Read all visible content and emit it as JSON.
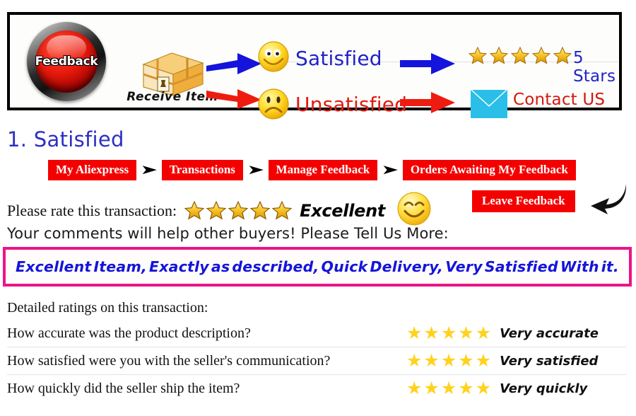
{
  "banner": {
    "feedback_button_label": "Feedback",
    "receive_item_label": "Receive Item",
    "satisfied_label": "Satisfied",
    "unsatisfied_label": "Unsatisfied",
    "five_stars_label": "5 Stars",
    "contact_us_label": "Contact US",
    "icons": {
      "package": "package-box-icon",
      "smile": "smiley-happy-icon",
      "frown": "smiley-sad-icon",
      "envelope": "envelope-icon",
      "blue_arrow": "arrow-right-blue-icon",
      "red_arrow": "arrow-right-red-icon"
    },
    "colors": {
      "satisfied_text": "#2222c8",
      "unsatisfied_text": "#e01b10",
      "blue_arrow": "#1414dc",
      "red_arrow": "#ee1c10",
      "envelope": "#29bfe8",
      "button_red": "#e81b0d"
    },
    "star_count": 5
  },
  "section": {
    "heading": "1. Satisfied"
  },
  "breadcrumb": {
    "separator": "➤",
    "items": [
      {
        "label": "My Aliexpress"
      },
      {
        "label": "Transactions"
      },
      {
        "label": "Manage Feedback"
      },
      {
        "label": "Orders Awaiting My Feedback"
      }
    ],
    "color": "#f40000"
  },
  "rating": {
    "prompt": "Please rate this transaction:",
    "stars": 5,
    "grade_label": "Excellent",
    "smiley_icon": "smiley-happy-icon",
    "leave_feedback_label": "Leave Feedback",
    "arrow_icon": "curved-arrow-icon"
  },
  "comments": {
    "prompt": "Your comments will help other buyers! Please Tell Us More:",
    "text": "Excellent Iteam, Exactly as described, Quick Delivery, Very Satisfied With it.",
    "words": [
      "Excellent",
      "Iteam,",
      "Exactly",
      "as",
      "described,",
      "Quick",
      "Delivery,",
      "Very",
      "Satisfied",
      "With",
      "it."
    ],
    "border_color": "#ec1489",
    "text_color": "#1414dc"
  },
  "detailed_ratings": {
    "title": "Detailed ratings on this transaction:",
    "star_color": "#ffd21e",
    "rows": [
      {
        "question": "How accurate was the product description?",
        "stars": 5,
        "value": "Very accurate"
      },
      {
        "question": "How satisfied were you with the seller's communication?",
        "stars": 5,
        "value": "Very satisfied"
      },
      {
        "question": "How quickly did the seller ship the item?",
        "stars": 5,
        "value": "Very quickly"
      }
    ]
  }
}
